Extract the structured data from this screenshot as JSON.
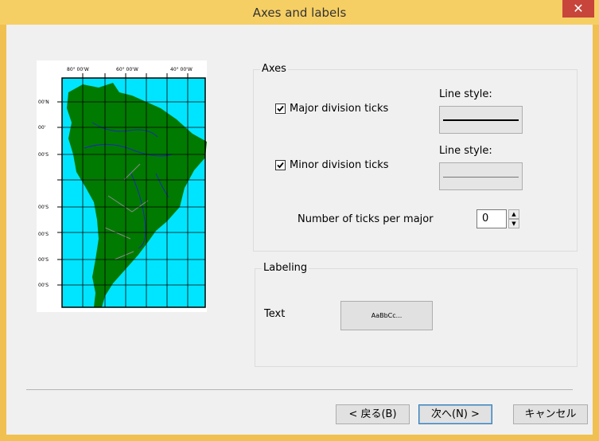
{
  "window": {
    "title": "Axes and labels",
    "close_glyph": "✕"
  },
  "preview": {
    "top_labels": [
      "80° 00'W",
      "60° 00'W",
      "40° 00'W"
    ],
    "left_labels": [
      "00'N",
      "00'",
      "00'S",
      "00'S",
      "00'S",
      "00'S",
      "00'S"
    ],
    "ocean_color": "#00e5ff",
    "land_color": "#007a00"
  },
  "axes": {
    "group_title": "Axes",
    "major_ticks": {
      "label": "Major division ticks",
      "checked": true,
      "line_style_label": "Line style:"
    },
    "minor_ticks": {
      "label": "Minor division ticks",
      "checked": true,
      "line_style_label": "Line style:"
    },
    "ticks_per_major": {
      "label": "Number of ticks per major",
      "value": "0"
    }
  },
  "labeling": {
    "group_title": "Labeling",
    "text_label": "Text",
    "font_sample": "AaBbCc..."
  },
  "buttons": {
    "back": "< 戻る(B)",
    "next": "次へ(N) >",
    "cancel": "キャンセル"
  }
}
